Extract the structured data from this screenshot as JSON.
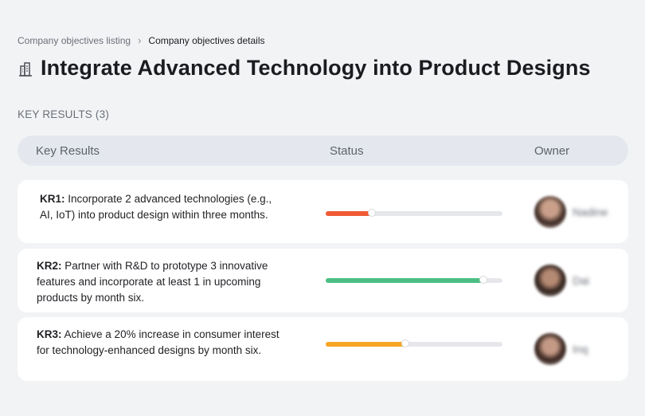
{
  "breadcrumb": {
    "parent": "Company objectives listing",
    "separator": "›",
    "current": "Company objectives details"
  },
  "page": {
    "title_icon": "building-icon",
    "title": "Integrate Advanced Technology into Product Designs"
  },
  "section": {
    "label": "KEY RESULTS (3)"
  },
  "table": {
    "columns": {
      "key_results": "Key Results",
      "status": "Status",
      "owner": "Owner"
    }
  },
  "key_results": [
    {
      "id": "KR1:",
      "text": " Incorporate 2 advanced technologies (e.g., AI, IoT) into product design within three months.",
      "progress": 0.26,
      "color": "#ef5a35",
      "owner": "Nadine"
    },
    {
      "id": "KR2:",
      "text": " Partner with R&D to prototype 3 innovative features and incorporate at least 1 in upcoming products by month six.",
      "progress": 0.89,
      "color": "#4dbf84",
      "owner": "Dai"
    },
    {
      "id": "KR3:",
      "text": " Achieve a 20% increase in consumer interest for technology-enhanced designs by month six.",
      "progress": 0.45,
      "color": "#f5a623",
      "owner": "Inq"
    }
  ]
}
